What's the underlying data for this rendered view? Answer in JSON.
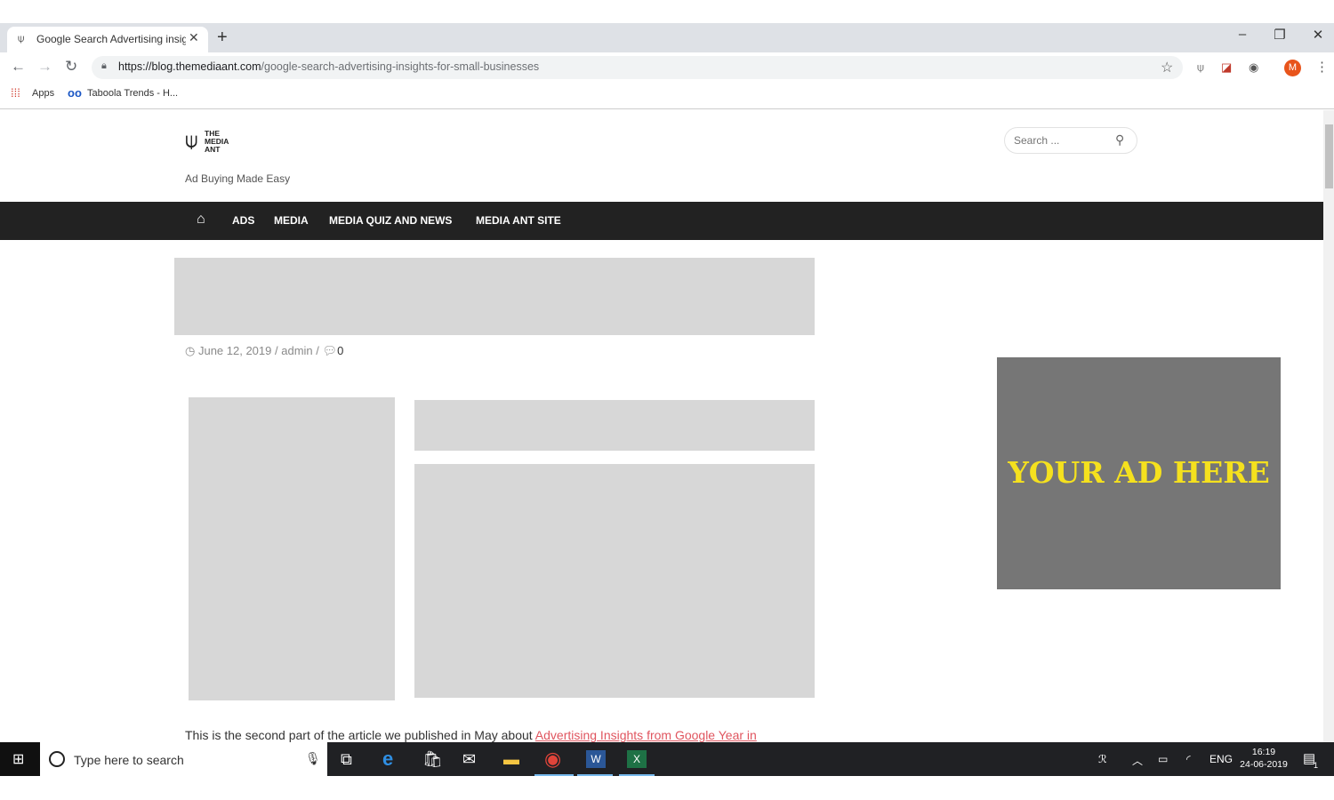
{
  "browser": {
    "tab_title": "Google Search Advertising insigh",
    "new_tab": "+",
    "url_host": "https://blog.themediaant.com",
    "url_path": "/google-search-advertising-insights-for-small-businesses",
    "avatar_letter": "M",
    "bookmarks": [
      {
        "label": "Apps"
      },
      {
        "label": "Taboola Trends - H..."
      }
    ]
  },
  "site": {
    "logo_lines": [
      "THE",
      "MEDIA",
      "ANT"
    ],
    "tagline": "Ad Buying Made Easy",
    "search_placeholder": "Search ...",
    "nav": [
      "ADS",
      "MEDIA",
      "MEDIA QUIZ AND NEWS",
      "MEDIA ANT SITE"
    ]
  },
  "post": {
    "date": "June 12, 2019",
    "sep1": "/",
    "author": "admin",
    "sep2": "/",
    "comment_count": "0",
    "body_intro": "This is the second part of the article we published in May about ",
    "body_link": "Advertising Insights from Google Year in"
  },
  "sidebar_ad": {
    "text": "YOUR AD HERE",
    "bg_color": "#767676",
    "text_color": "#f5e11e"
  },
  "taskbar": {
    "search_placeholder": "Type here to search",
    "lang": "ENG",
    "time": "16:19",
    "date": "24-06-2019",
    "notification_count": "1"
  }
}
